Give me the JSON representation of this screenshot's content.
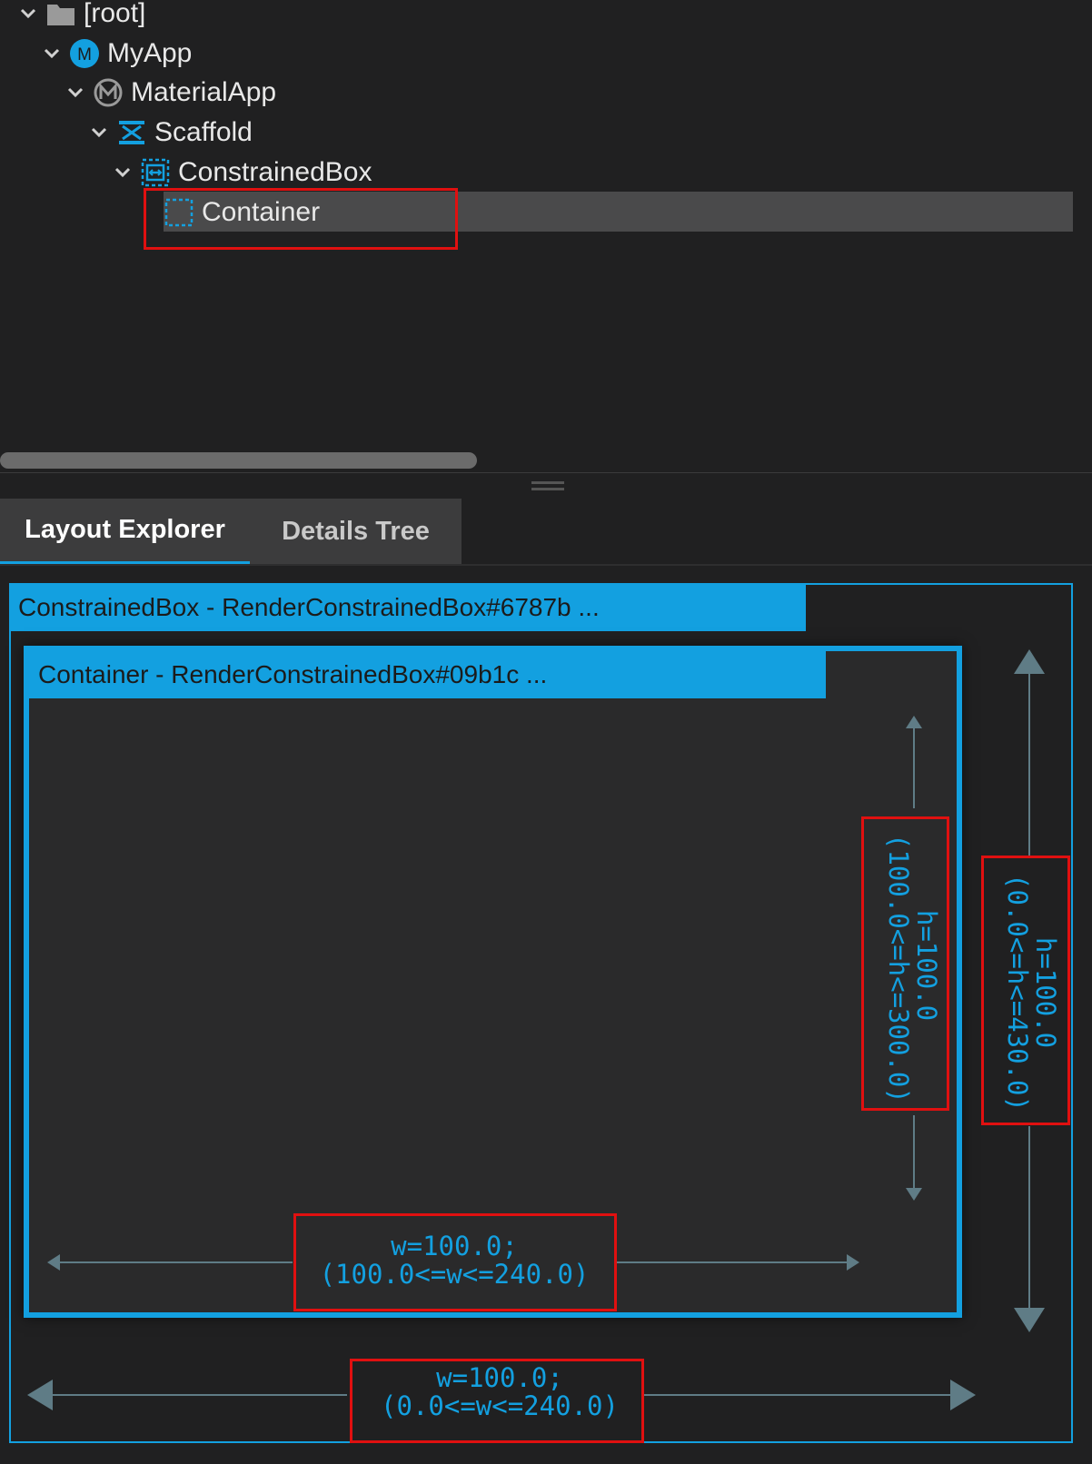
{
  "tree": {
    "nodes": [
      {
        "label": "[root]",
        "icon": "folder-icon"
      },
      {
        "label": "MyApp",
        "icon": "m-circle-icon"
      },
      {
        "label": "MaterialApp",
        "icon": "material-app-icon"
      },
      {
        "label": "Scaffold",
        "icon": "scaffold-icon"
      },
      {
        "label": "ConstrainedBox",
        "icon": "constrained-box-icon"
      },
      {
        "label": "Container",
        "icon": "container-icon"
      }
    ],
    "selected": "Container"
  },
  "tabs": {
    "layout_explorer": "Layout Explorer",
    "details_tree": "Details Tree"
  },
  "explorer": {
    "outer_header": "ConstrainedBox - RenderConstrainedBox#6787b ...",
    "inner_header": "Container - RenderConstrainedBox#09b1c ...",
    "inner_height": {
      "line1": "h=100.0",
      "line2": "(100.0<=h<=300.0)"
    },
    "outer_height": {
      "line1": "h=100.0",
      "line2": "(0.0<=h<=430.0)"
    },
    "inner_width": {
      "line1": "w=100.0;",
      "line2": "(100.0<=w<=240.0)"
    },
    "outer_width": {
      "line1": "w=100.0;",
      "line2": "(0.0<=w<=240.0)"
    }
  },
  "colors": {
    "accent": "#13a0e0",
    "highlight_box": "#e01010",
    "arrow": "#5f7c86",
    "background": "#202021"
  }
}
